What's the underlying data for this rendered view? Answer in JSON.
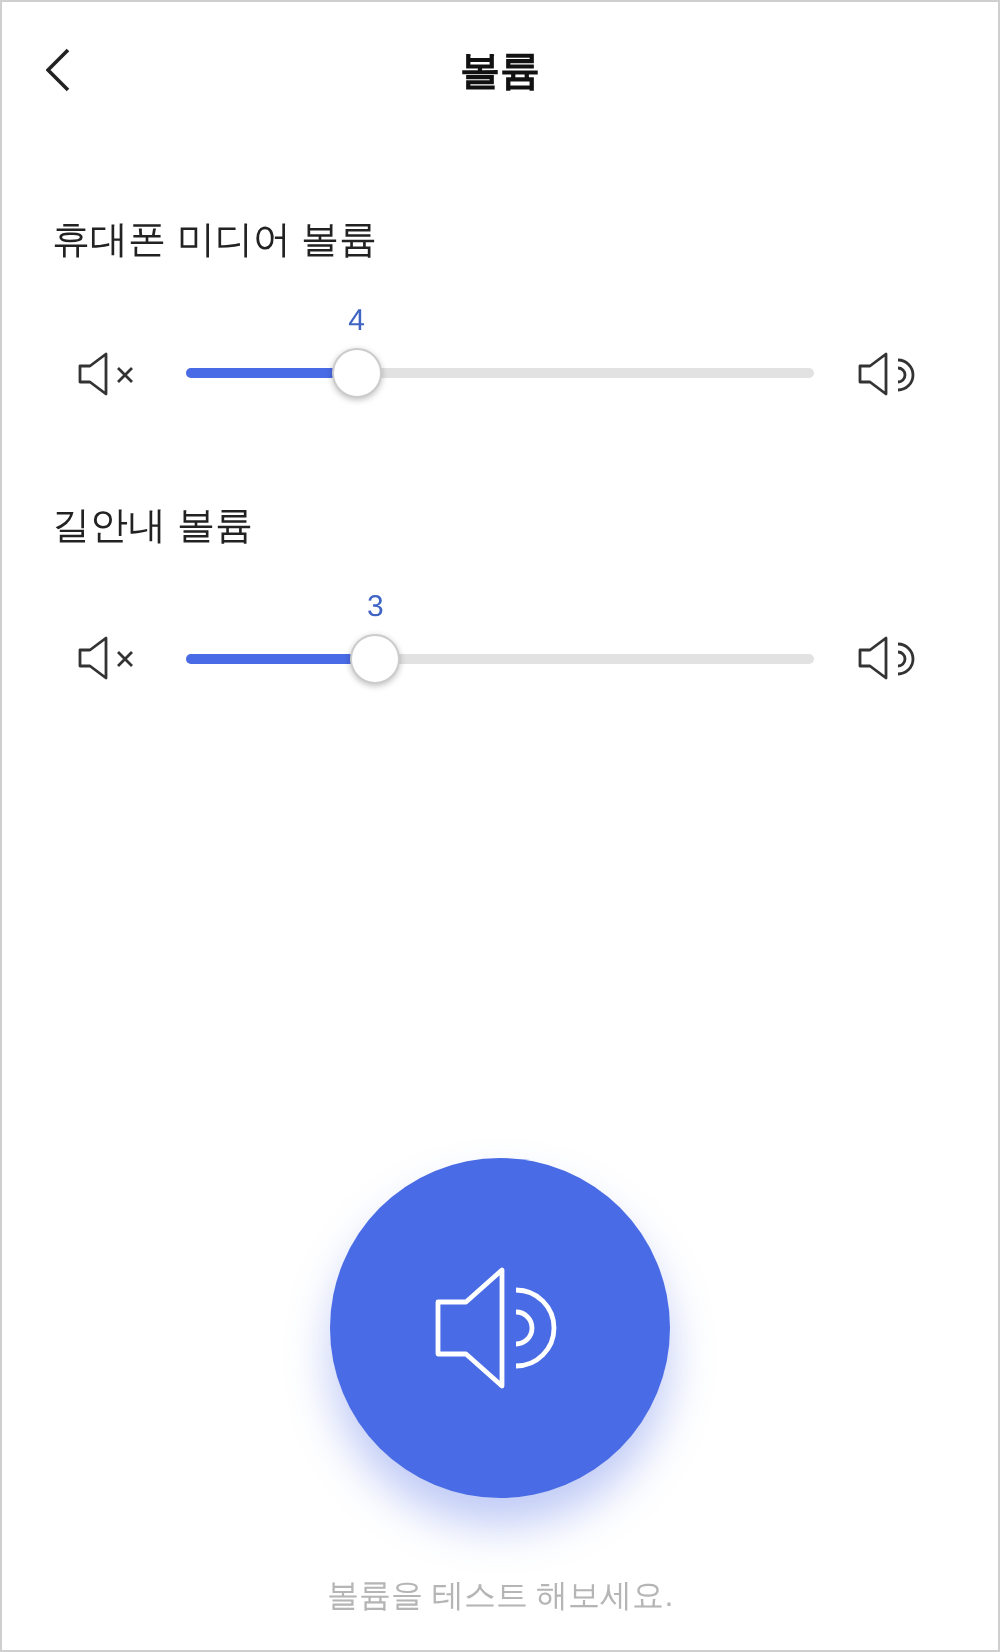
{
  "header": {
    "title": "볼륨"
  },
  "sliders": [
    {
      "label": "휴대폰 미디어 볼륨",
      "value": "4",
      "level": 0.27
    },
    {
      "label": "길안내 볼륨",
      "value": "3",
      "level": 0.3
    }
  ],
  "test": {
    "caption": "볼륨을 테스트 해보세요."
  }
}
